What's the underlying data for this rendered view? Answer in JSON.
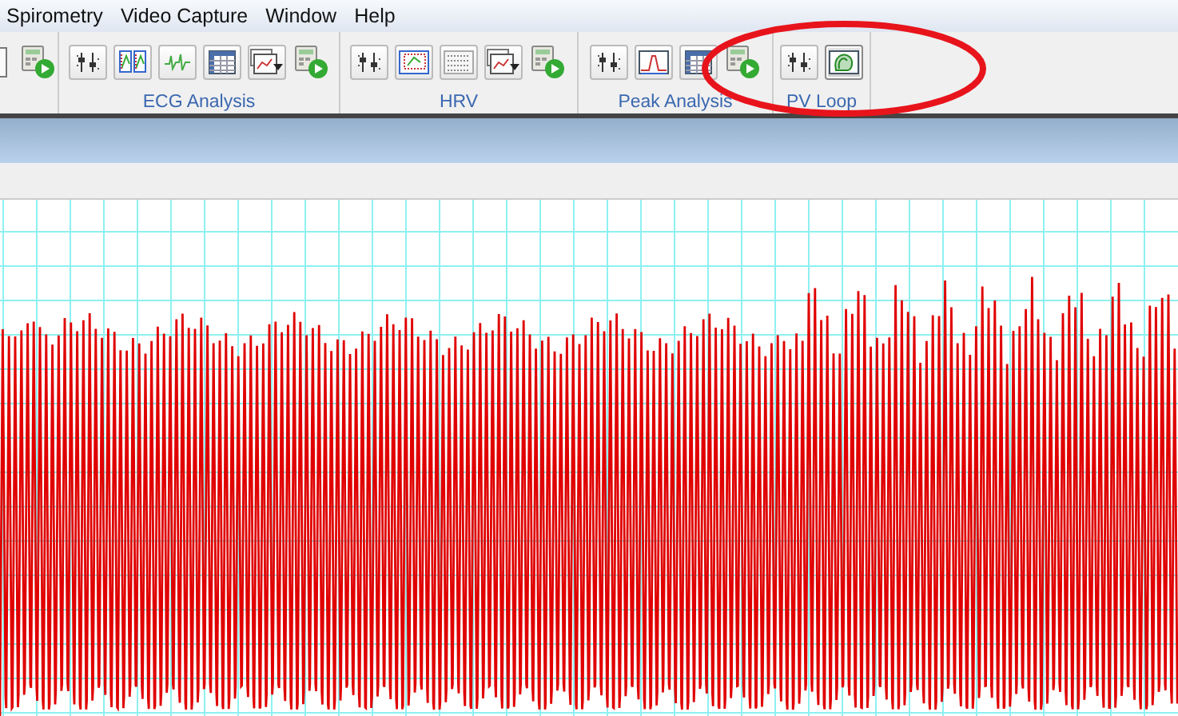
{
  "menu_bar": {
    "items": [
      "Spirometry",
      "Video Capture",
      "Window",
      "Help"
    ]
  },
  "toolbar": {
    "groups": [
      {
        "buttons": [
          {
            "kind": "partial",
            "selected": false
          },
          {
            "kind": "run",
            "selected": false
          }
        ]
      },
      {
        "label": "ECG Analysis",
        "buttons": [
          {
            "kind": "settings",
            "selected": false
          },
          {
            "kind": "dual-chart",
            "selected": false
          },
          {
            "kind": "wave",
            "selected": false
          },
          {
            "kind": "table",
            "selected": false
          },
          {
            "kind": "chart-menu",
            "selected": false
          },
          {
            "kind": "run",
            "selected": false
          }
        ]
      },
      {
        "label": "HRV",
        "buttons": [
          {
            "kind": "settings",
            "selected": false
          },
          {
            "kind": "scatter",
            "selected": false
          },
          {
            "kind": "list",
            "selected": false
          },
          {
            "kind": "chart-menu",
            "selected": false
          },
          {
            "kind": "run",
            "selected": false
          }
        ]
      },
      {
        "label": "Peak Analysis",
        "buttons": [
          {
            "kind": "settings",
            "selected": false
          },
          {
            "kind": "peak",
            "selected": false
          },
          {
            "kind": "table",
            "selected": false
          },
          {
            "kind": "run",
            "selected": false
          }
        ]
      },
      {
        "label": "PV Loop",
        "buttons": [
          {
            "kind": "settings",
            "selected": false
          },
          {
            "kind": "loop",
            "selected": true
          }
        ]
      }
    ]
  }
}
